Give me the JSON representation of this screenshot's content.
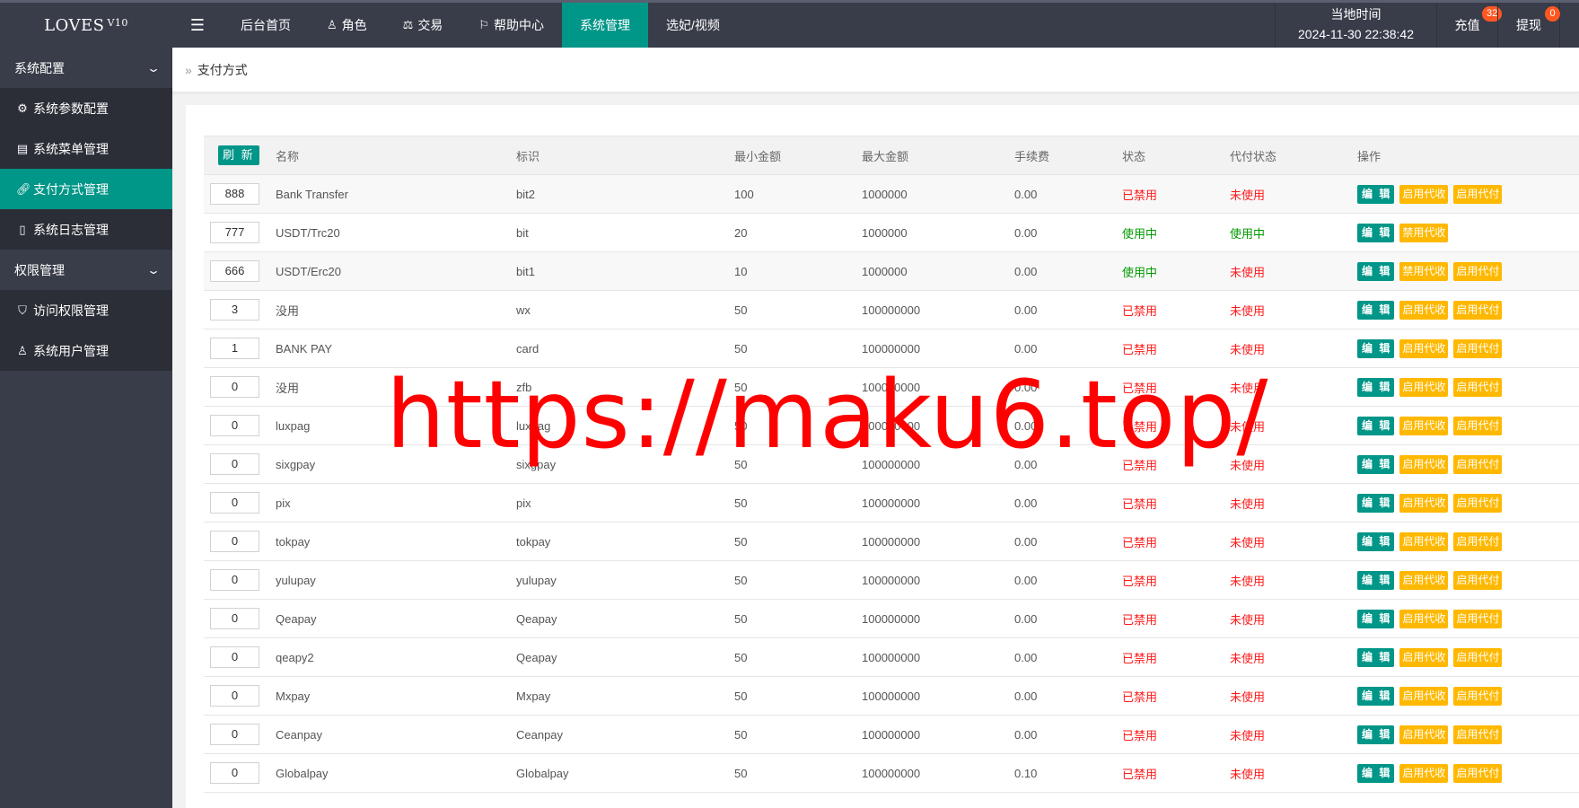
{
  "header": {
    "logo": "LOVES",
    "logo_version": "V10",
    "menu_icon": "hamburger-icon",
    "nav": [
      {
        "label": "后台首页",
        "icon": ""
      },
      {
        "label": "角色",
        "icon": "user-icon"
      },
      {
        "label": "交易",
        "icon": "scale-icon"
      },
      {
        "label": "帮助中心",
        "icon": "flag-icon"
      },
      {
        "label": "系统管理",
        "icon": "",
        "active": true
      },
      {
        "label": "选妃/视频",
        "icon": ""
      }
    ],
    "clock_label": "当地时间",
    "clock_value": "2024-11-30 22:38:42",
    "recharge": {
      "label": "充值",
      "badge": "32"
    },
    "withdraw": {
      "label": "提现",
      "badge": "0"
    }
  },
  "sidebar": {
    "groups": [
      {
        "label": "系统配置",
        "items": [
          {
            "label": "系统参数配置",
            "icon": "gear-icon"
          },
          {
            "label": "系统菜单管理",
            "icon": "window-icon"
          },
          {
            "label": "支付方式管理",
            "icon": "link-icon",
            "active": true
          },
          {
            "label": "系统日志管理",
            "icon": "clipboard-icon"
          }
        ]
      },
      {
        "label": "权限管理",
        "items": [
          {
            "label": "访问权限管理",
            "icon": "shield-icon"
          },
          {
            "label": "系统用户管理",
            "icon": "user-icon"
          }
        ]
      }
    ]
  },
  "breadcrumb": {
    "icon": "double-chevron-icon",
    "label": "支付方式"
  },
  "table": {
    "refresh_label": "刷 新",
    "columns": [
      "名称",
      "标识",
      "最小金额",
      "最大金额",
      "手续费",
      "状态",
      "代付状态",
      "操作"
    ],
    "actions": {
      "edit": "编 辑",
      "enable_collect": "启用代收",
      "disable_collect": "禁用代收",
      "enable_pay": "启用代付"
    },
    "rows": [
      {
        "sort": "888",
        "name": "Bank Transfer",
        "code": "bit2",
        "min": "100",
        "max": "1000000",
        "fee": "0.00",
        "status": "已禁用",
        "payout": "未使用",
        "collect_btn": "enable_collect",
        "pay_btn": true
      },
      {
        "sort": "777",
        "name": "USDT/Trc20",
        "code": "bit",
        "min": "20",
        "max": "1000000",
        "fee": "0.00",
        "status": "使用中",
        "payout": "使用中",
        "collect_btn": "disable_collect",
        "pay_btn": false
      },
      {
        "sort": "666",
        "name": "USDT/Erc20",
        "code": "bit1",
        "min": "10",
        "max": "1000000",
        "fee": "0.00",
        "status": "使用中",
        "payout": "未使用",
        "collect_btn": "disable_collect",
        "pay_btn": true
      },
      {
        "sort": "3",
        "name": "没用",
        "code": "wx",
        "min": "50",
        "max": "100000000",
        "fee": "0.00",
        "status": "已禁用",
        "payout": "未使用",
        "collect_btn": "enable_collect",
        "pay_btn": true
      },
      {
        "sort": "1",
        "name": "BANK PAY",
        "code": "card",
        "min": "50",
        "max": "100000000",
        "fee": "0.00",
        "status": "已禁用",
        "payout": "未使用",
        "collect_btn": "enable_collect",
        "pay_btn": true
      },
      {
        "sort": "0",
        "name": "没用",
        "code": "zfb",
        "min": "50",
        "max": "100000000",
        "fee": "0.00",
        "status": "已禁用",
        "payout": "未使用",
        "collect_btn": "enable_collect",
        "pay_btn": true
      },
      {
        "sort": "0",
        "name": "luxpag",
        "code": "luxpag",
        "min": "50",
        "max": "100000000",
        "fee": "0.00",
        "status": "已禁用",
        "payout": "未使用",
        "collect_btn": "enable_collect",
        "pay_btn": true
      },
      {
        "sort": "0",
        "name": "sixgpay",
        "code": "sixgpay",
        "min": "50",
        "max": "100000000",
        "fee": "0.00",
        "status": "已禁用",
        "payout": "未使用",
        "collect_btn": "enable_collect",
        "pay_btn": true
      },
      {
        "sort": "0",
        "name": "pix",
        "code": "pix",
        "min": "50",
        "max": "100000000",
        "fee": "0.00",
        "status": "已禁用",
        "payout": "未使用",
        "collect_btn": "enable_collect",
        "pay_btn": true
      },
      {
        "sort": "0",
        "name": "tokpay",
        "code": "tokpay",
        "min": "50",
        "max": "100000000",
        "fee": "0.00",
        "status": "已禁用",
        "payout": "未使用",
        "collect_btn": "enable_collect",
        "pay_btn": true
      },
      {
        "sort": "0",
        "name": "yulupay",
        "code": "yulupay",
        "min": "50",
        "max": "100000000",
        "fee": "0.00",
        "status": "已禁用",
        "payout": "未使用",
        "collect_btn": "enable_collect",
        "pay_btn": true
      },
      {
        "sort": "0",
        "name": "Qeapay",
        "code": "Qeapay",
        "min": "50",
        "max": "100000000",
        "fee": "0.00",
        "status": "已禁用",
        "payout": "未使用",
        "collect_btn": "enable_collect",
        "pay_btn": true
      },
      {
        "sort": "0",
        "name": "qeapy2",
        "code": "Qeapay",
        "min": "50",
        "max": "100000000",
        "fee": "0.00",
        "status": "已禁用",
        "payout": "未使用",
        "collect_btn": "enable_collect",
        "pay_btn": true
      },
      {
        "sort": "0",
        "name": "Mxpay",
        "code": "Mxpay",
        "min": "50",
        "max": "100000000",
        "fee": "0.00",
        "status": "已禁用",
        "payout": "未使用",
        "collect_btn": "enable_collect",
        "pay_btn": true
      },
      {
        "sort": "0",
        "name": "Ceanpay",
        "code": "Ceanpay",
        "min": "50",
        "max": "100000000",
        "fee": "0.00",
        "status": "已禁用",
        "payout": "未使用",
        "collect_btn": "enable_collect",
        "pay_btn": true
      },
      {
        "sort": "0",
        "name": "Globalpay",
        "code": "Globalpay",
        "min": "50",
        "max": "100000000",
        "fee": "0.10",
        "status": "已禁用",
        "payout": "未使用",
        "collect_btn": "enable_collect",
        "pay_btn": true
      }
    ]
  },
  "watermark": "https://maku6.top/",
  "colors": {
    "header_bg": "#393d49",
    "accent": "#009688",
    "warn": "#ffb800",
    "danger": "#ff1a1a",
    "ok": "#009900",
    "badge": "#ff5722",
    "watermark": "#ff0000"
  }
}
